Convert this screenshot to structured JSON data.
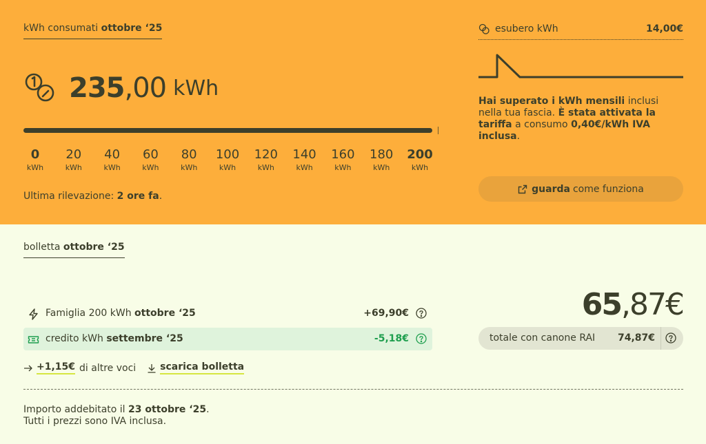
{
  "consumption": {
    "title_prefix": "kWh consumati",
    "title_period": "ottobre ‘25",
    "value_int": "235",
    "value_dec": ",00",
    "unit": "kWh",
    "progress_fraction": 1.0,
    "scale": [
      {
        "n": "0",
        "u": "kWh",
        "bold": true
      },
      {
        "n": "20",
        "u": "kWh",
        "bold": false
      },
      {
        "n": "40",
        "u": "kWh",
        "bold": false
      },
      {
        "n": "60",
        "u": "kWh",
        "bold": false
      },
      {
        "n": "80",
        "u": "kWh",
        "bold": false
      },
      {
        "n": "100",
        "u": "kWh",
        "bold": false
      },
      {
        "n": "120",
        "u": "kWh",
        "bold": false
      },
      {
        "n": "140",
        "u": "kWh",
        "bold": false
      },
      {
        "n": "160",
        "u": "kWh",
        "bold": false
      },
      {
        "n": "180",
        "u": "kWh",
        "bold": false
      },
      {
        "n": "200",
        "u": "kWh",
        "bold": true
      }
    ],
    "last_read_prefix": "Ultima rilevazione:",
    "last_read_value": "2 ore fa",
    "last_read_suffix": "."
  },
  "excess": {
    "label": "esubero kWh",
    "value": "14,00€",
    "warn_bold_1": "Hai superato i kWh mensili",
    "warn_text_1": " inclusi nella tua fascia. ",
    "warn_bold_2": "È stata attivata la tariffa",
    "warn_text_2": " a consumo ",
    "warn_bold_3": "0,40€/kWh IVA inclusa",
    "warn_text_3": ".",
    "howto_bold": "guarda",
    "howto_text": "come funziona"
  },
  "bill": {
    "title_prefix": "bolletta",
    "title_period": "ottobre ‘25",
    "rows": [
      {
        "label": "Famiglia 200 kWh",
        "period": "ottobre ‘25",
        "amount": "+69,90€",
        "icon": "lightning-icon"
      },
      {
        "label": "credito kWh",
        "period": "settembre ‘25",
        "amount": "-5,18€",
        "icon": "ticket-icon"
      }
    ],
    "extra_amount": "+1,15€",
    "extra_text": "di altre voci",
    "download_label": "scarica bolletta",
    "total_int": "65",
    "total_dec": ",87€",
    "canone_label": "totale con canone RAI",
    "canone_value": "74,87€",
    "charged_prefix": "Importo addebitato il",
    "charged_date": "23 ottobre ‘25",
    "charged_suffix": ".",
    "vat_note": "Tutti i prezzi sono IVA inclusa."
  },
  "colors": {
    "top_bg": "#fdae3b",
    "bottom_bg": "#f8fde7",
    "ink": "#3c3f2b",
    "credit_green": "#1e9e4e",
    "highlight": "#d6e63f"
  }
}
